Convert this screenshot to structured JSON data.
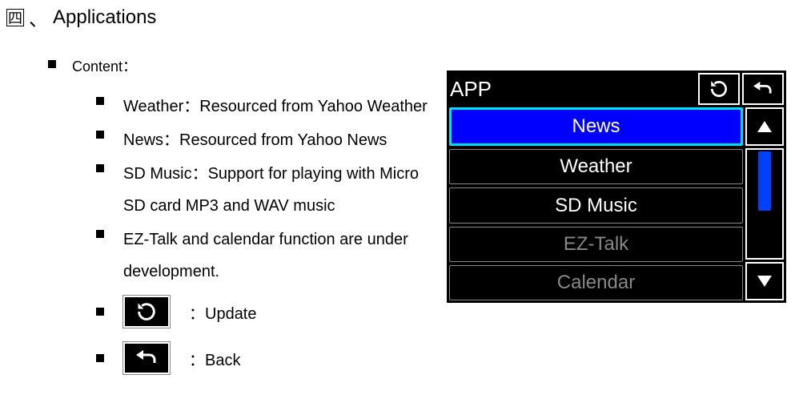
{
  "section": {
    "number_glyph": "四",
    "separator": "、",
    "title": "Applications"
  },
  "content_label": "Content：",
  "items": [
    {
      "text": "Weather：Resourced from Yahoo Weather"
    },
    {
      "text": "News：Resourced from Yahoo News"
    },
    {
      "text": "SD Music：Support for playing with Micro SD card MP3 and WAV music"
    },
    {
      "text": "EZ-Talk and calendar function are under development."
    }
  ],
  "icon_items": [
    {
      "icon": "refresh-icon",
      "label": "：Update"
    },
    {
      "icon": "back-icon",
      "label": "：Back"
    }
  ],
  "device": {
    "title": "APP",
    "menu": [
      {
        "label": "News",
        "state": "selected"
      },
      {
        "label": "Weather",
        "state": "normal"
      },
      {
        "label": "SD Music",
        "state": "normal"
      },
      {
        "label": "EZ-Talk",
        "state": "dim"
      },
      {
        "label": "Calendar",
        "state": "dim"
      }
    ]
  }
}
